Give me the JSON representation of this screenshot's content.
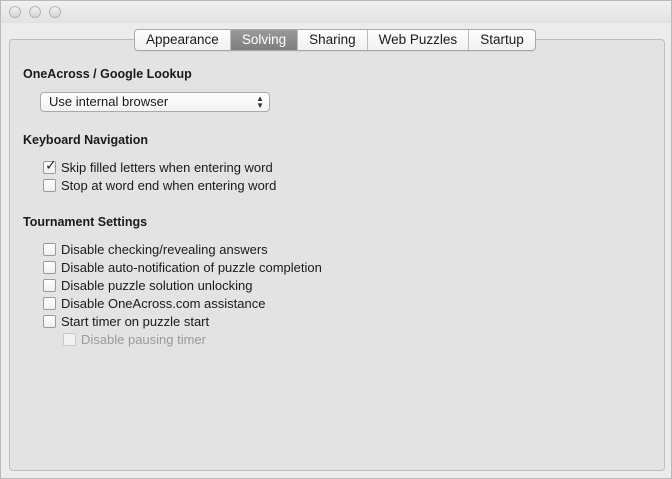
{
  "tabs": [
    {
      "label": "Appearance",
      "selected": false
    },
    {
      "label": "Solving",
      "selected": true
    },
    {
      "label": "Sharing",
      "selected": false
    },
    {
      "label": "Web Puzzles",
      "selected": false
    },
    {
      "label": "Startup",
      "selected": false
    }
  ],
  "lookup": {
    "title": "OneAcross / Google Lookup",
    "selected_option": "Use internal browser"
  },
  "keyboard": {
    "title": "Keyboard Navigation",
    "options": [
      {
        "label": "Skip filled letters when entering word",
        "checked": true
      },
      {
        "label": "Stop at word end when entering word",
        "checked": false
      }
    ]
  },
  "tournament": {
    "title": "Tournament Settings",
    "options": [
      {
        "label": "Disable checking/revealing answers",
        "checked": false
      },
      {
        "label": "Disable auto-notification of puzzle completion",
        "checked": false
      },
      {
        "label": "Disable puzzle solution unlocking",
        "checked": false
      },
      {
        "label": "Disable OneAcross.com assistance",
        "checked": false
      },
      {
        "label": "Start timer on puzzle start",
        "checked": false
      },
      {
        "label": "Disable pausing timer",
        "checked": false,
        "disabled": true
      }
    ]
  },
  "colors": {
    "selected_tab": "#8a8a8a",
    "pane": "#e3e3e3"
  }
}
